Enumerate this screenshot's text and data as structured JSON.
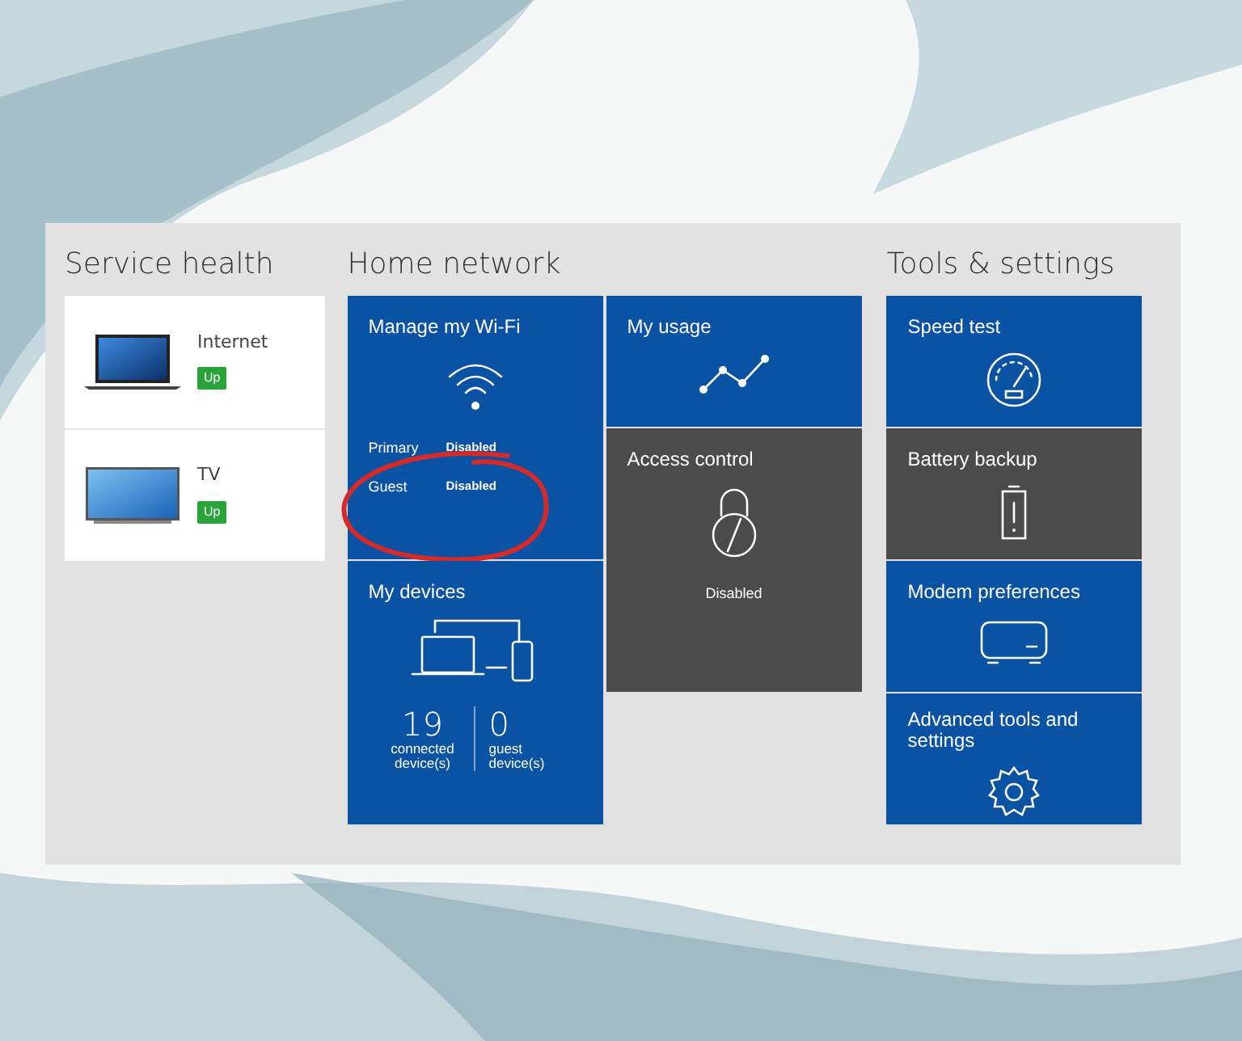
{
  "service_health": {
    "title": "Service health",
    "items": [
      {
        "kind": "laptop",
        "label": "Internet",
        "status": "Up"
      },
      {
        "kind": "tv",
        "label": "TV",
        "status": "Up"
      }
    ]
  },
  "home_network": {
    "title": "Home network",
    "columns": [
      [
        {
          "kind": "wifi",
          "title": "Manage my Wi-Fi",
          "disabled": false,
          "networks": [
            {
              "name": "Primary",
              "state": "Disabled"
            },
            {
              "name": "Guest",
              "state": "Disabled"
            }
          ]
        },
        {
          "kind": "devices",
          "title": "My devices",
          "disabled": false,
          "stats": [
            {
              "value": "19",
              "label": "connected device(s)"
            },
            {
              "value": "0",
              "label": "guest device(s)"
            }
          ]
        }
      ],
      [
        {
          "kind": "usage",
          "title": "My usage",
          "disabled": false
        },
        {
          "kind": "access",
          "title": "Access control",
          "disabled": true,
          "note": "Disabled"
        }
      ]
    ]
  },
  "tools": {
    "title": "Tools & settings",
    "tiles": [
      {
        "kind": "speed",
        "title": "Speed test",
        "disabled": false
      },
      {
        "kind": "battery",
        "title": "Battery backup",
        "disabled": true
      },
      {
        "kind": "modem",
        "title": "Modem preferences",
        "disabled": false
      },
      {
        "kind": "advanced",
        "title": "Advanced tools and settings",
        "disabled": false
      }
    ]
  }
}
